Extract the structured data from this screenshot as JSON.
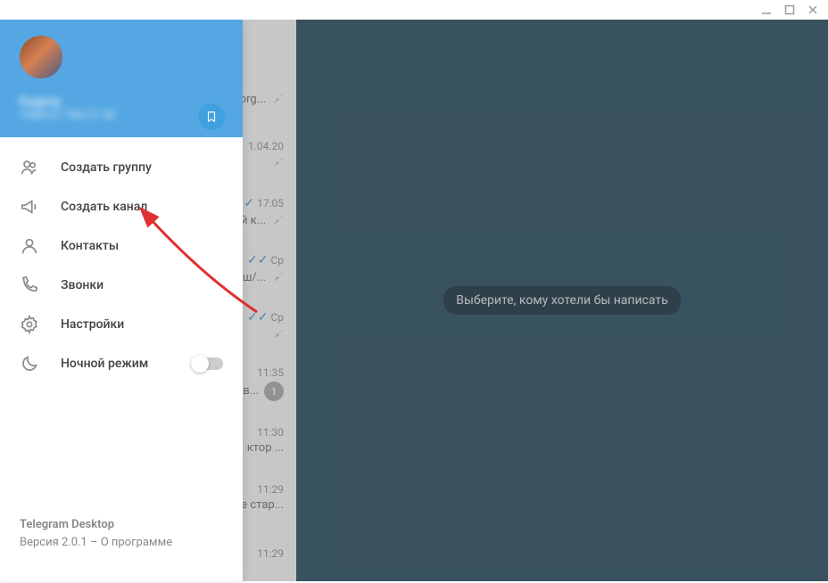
{
  "header": {
    "user_name": "Eugeny",
    "user_phone": "+380 67 744 21 42"
  },
  "menu": {
    "items": [
      {
        "label": "Создать группу",
        "icon": "group"
      },
      {
        "label": "Создать канал",
        "icon": "megaphone"
      },
      {
        "label": "Контакты",
        "icon": "person"
      },
      {
        "label": "Звонки",
        "icon": "phone"
      },
      {
        "label": "Настройки",
        "icon": "gear"
      },
      {
        "label": "Ночной режим",
        "icon": "moon",
        "toggle": false
      }
    ],
    "footer": {
      "title": "Telegram Desktop",
      "version": "Версия 2.0.1 – О программе"
    }
  },
  "chats": [
    {
      "preview": "nx.org...",
      "time": "",
      "pinned": true
    },
    {
      "preview": "",
      "time": "1.04.20",
      "pinned": true
    },
    {
      "preview": "й к...",
      "time": "17:05",
      "check": true,
      "pinned": true
    },
    {
      "preview": "ш/...",
      "time": "Ср",
      "check": true,
      "pinned": true
    },
    {
      "preview": "",
      "time": "Ср",
      "check": true,
      "pinned": true
    },
    {
      "preview": "ав...",
      "time": "11:35",
      "badge": "1"
    },
    {
      "preview": "ктор ...",
      "time": "11:30"
    },
    {
      "preview": "е стар...",
      "time": "11:29"
    },
    {
      "preview": "",
      "time": "11:29"
    }
  ],
  "main": {
    "empty_label": "Выберите, кому хотели бы написать"
  }
}
